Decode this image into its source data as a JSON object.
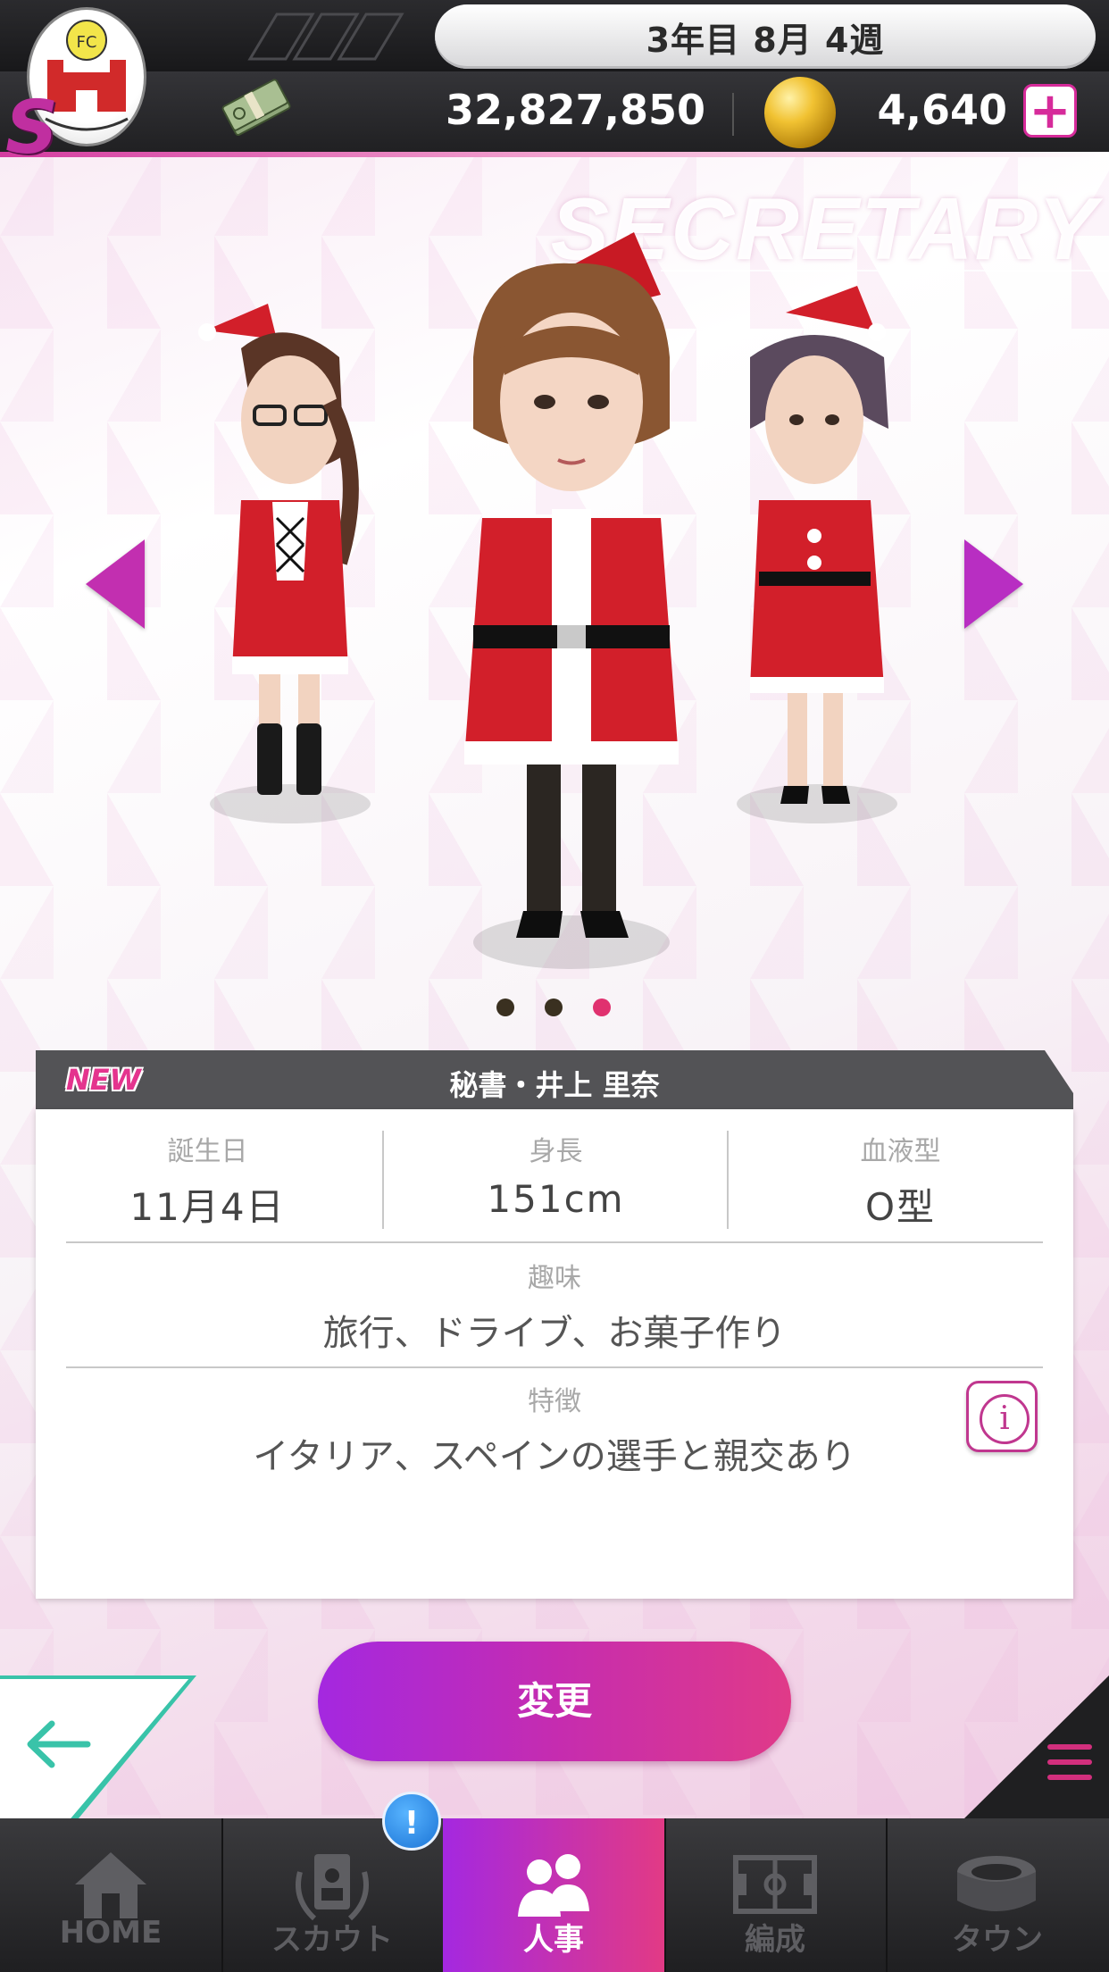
{
  "header": {
    "date": "3年目 8月 4週",
    "money": "32,827,850",
    "coins": "4,640",
    "plus_label": "+",
    "rank_letter": "S"
  },
  "hero": {
    "title": "SECRETARY"
  },
  "carousel": {
    "page_count": 3,
    "current_page": 3
  },
  "profile": {
    "badge": "NEW",
    "title": "秘書・井上 里奈",
    "birthday_label": "誕生日",
    "birthday": "11月4日",
    "height_label": "身長",
    "height": "151cm",
    "blood_label": "血液型",
    "blood": "O型",
    "hobby_label": "趣味",
    "hobby": "旅行、ドライブ、お菓子作り",
    "trait_label": "特徴",
    "trait": "イタリア、スペインの選手と親交あり",
    "info_icon": "i"
  },
  "actions": {
    "change_label": "変更"
  },
  "tabs": [
    {
      "label": "HOME",
      "icon": "house-icon"
    },
    {
      "label": "スカウト",
      "icon": "scout-badge-icon"
    },
    {
      "label": "人事",
      "icon": "people-icon"
    },
    {
      "label": "編成",
      "icon": "pitch-icon"
    },
    {
      "label": "タウン",
      "icon": "stadium-icon"
    }
  ],
  "notification": "!",
  "colors": {
    "accent_pink": "#e0316f",
    "accent_purple": "#a428e0",
    "header_dark": "#202022"
  }
}
